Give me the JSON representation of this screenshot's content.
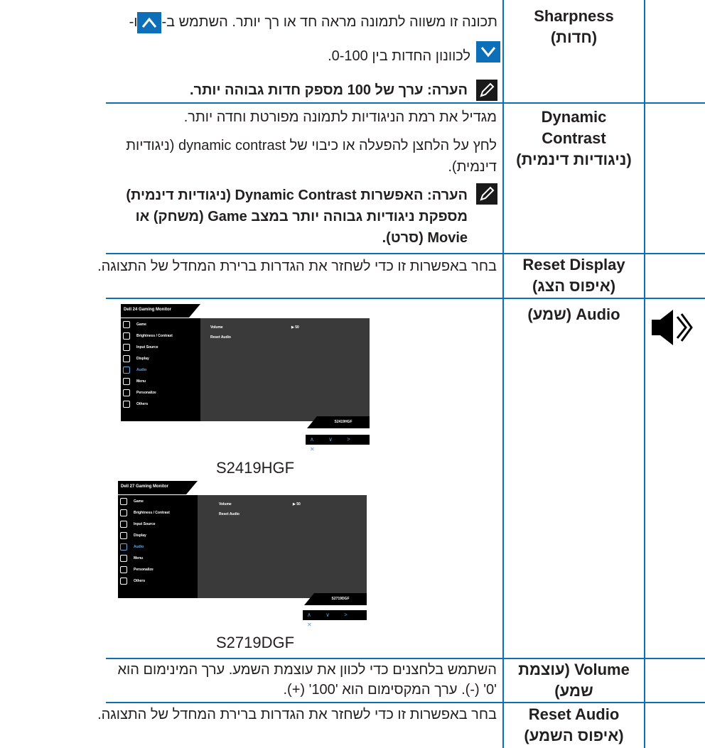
{
  "colors": {
    "rule": "#0c6fb8",
    "accent": "#0c6fb8"
  },
  "rows": {
    "sharpness": {
      "label_en": "Sharpness",
      "label_he": "(חדות)",
      "desc_line1_a": "תכונה זו משווה לתמונה מראה חד או רך יותר. השתמש ב-",
      "desc_line1_b": "ו-",
      "desc_line2": "לכוונון החדות בין 0-100.",
      "note": "הערה: ערך של 100 מספק חדות גבוהה יותר."
    },
    "dynamic_contrast": {
      "label_en1": "Dynamic",
      "label_en2": "Contrast",
      "label_he": "(ניגודיות דינמית)",
      "desc_p1": "מגדיל את רמת הניגודיות לתמונה מפורטת וחדה יותר.",
      "desc_p2_line1": "לחץ על הלחצן להפעלה או כיבוי של dynamic contrast (ניגודיות",
      "desc_p2_line2": "דינמית).",
      "note_line1": "הערה: האפשרות Dynamic Contrast (ניגודיות דינמית)",
      "note_line2": "מספקת ניגודיות גבוהה יותר במצב Game (משחק) או",
      "note_line3": "Movie (סרט)."
    },
    "reset_display": {
      "label_en": "Reset Display",
      "label_he": "(איפוס הצג)",
      "desc": "בחר באפשרות זו כדי לשחזר את הגדרות ברירת המחדל של התצוגה."
    },
    "audio": {
      "label": "Audio (שמע)",
      "icon": "speaker-icon",
      "screens": [
        {
          "caption": "S2419HGF",
          "osd_title": "Dell 24 Gaming Monitor",
          "model_tag": "S2419HGF"
        },
        {
          "caption": "S2719DGF",
          "osd_title": "Dell 27 Gaming Monitor",
          "model_tag": "S2719DGF"
        }
      ],
      "osd_menu": [
        "Game",
        "Brightness / Contrast",
        "Input Source",
        "Display",
        "Audio",
        "Menu",
        "Personalize",
        "Others"
      ],
      "osd_active": "Audio",
      "osd_volume_label": "Volume",
      "osd_volume_value": "▶ 50",
      "osd_reset_audio": "Reset Audio",
      "osd_nav": "∧ ∨ > ✕"
    },
    "volume": {
      "label_line1": "Volume (עוצמת",
      "label_line2": "שמע)",
      "desc_line1": "השתמש בלחצנים כדי לכוון את עוצמת השמע. ערך המינימום הוא",
      "desc_line2": "'0' (-). ערך המקסימום הוא '100' (+)."
    },
    "reset_audio": {
      "label_en": "Reset Audio",
      "label_he": "(איפוס השמע)",
      "desc": "בחר באפשרות זו כדי לשחזר את הגדרות ברירת המחדל של התצוגה."
    }
  }
}
